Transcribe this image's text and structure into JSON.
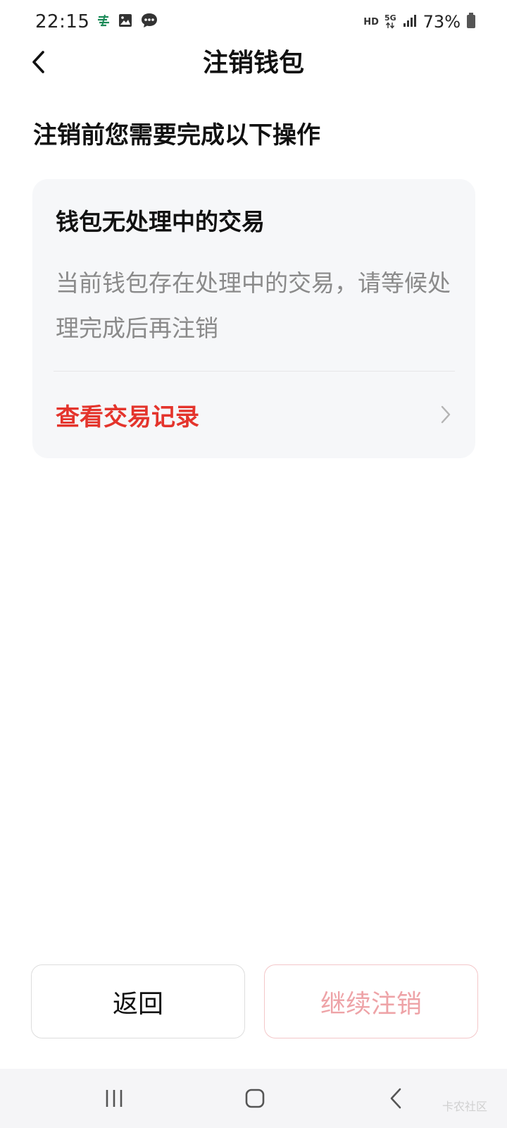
{
  "status_bar": {
    "time": "22:15",
    "hd_label": "HD",
    "network_label": "5G",
    "battery_percent": "73%",
    "icons": [
      "bank-icon",
      "image-icon",
      "message-icon",
      "signal-icon",
      "battery-icon"
    ]
  },
  "header": {
    "title": "注销钱包",
    "back_icon": "chevron-left-icon"
  },
  "section": {
    "heading": "注销前您需要完成以下操作"
  },
  "card": {
    "title": "钱包无处理中的交易",
    "description": "当前钱包存在处理中的交易，请等候处理完成后再注销",
    "link_label": "查看交易记录",
    "link_icon": "chevron-right-icon"
  },
  "buttons": {
    "back_label": "返回",
    "continue_label": "继续注销"
  },
  "system_nav": {
    "icons": [
      "recent-apps-icon",
      "home-icon",
      "back-icon"
    ]
  },
  "watermark": "卡农社区",
  "colors": {
    "accent_red": "#e4342c",
    "disabled_red_text": "#eea3a7",
    "card_bg": "#f6f7f9",
    "muted_text": "#8a8a8a"
  }
}
